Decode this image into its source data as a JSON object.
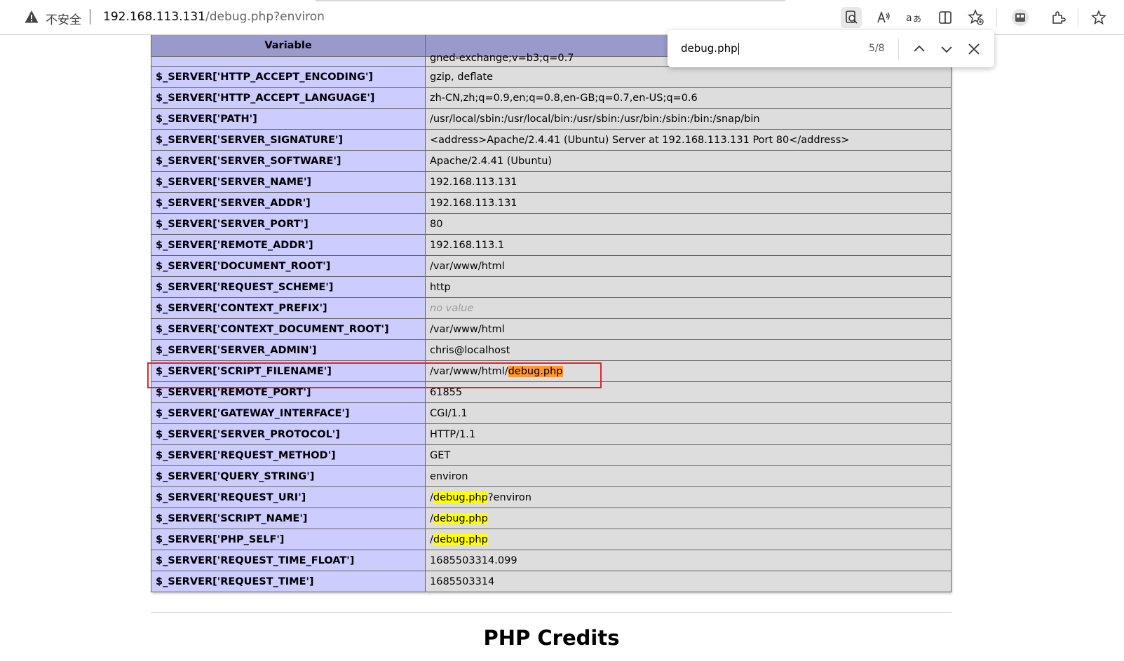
{
  "browser": {
    "security_label": "不安全",
    "url_host": "192.168.113.131",
    "url_rest": "/debug.php?environ"
  },
  "find": {
    "query": "debug.php",
    "count": "5/8"
  },
  "table": {
    "header_variable": "Variable",
    "partial_value": "gned-exchange;v=b3;q=0.7",
    "rows": [
      {
        "name": "$_SERVER['HTTP_ACCEPT_ENCODING']",
        "value": "gzip, deflate"
      },
      {
        "name": "$_SERVER['HTTP_ACCEPT_LANGUAGE']",
        "value": "zh-CN,zh;q=0.9,en;q=0.8,en-GB;q=0.7,en-US;q=0.6"
      },
      {
        "name": "$_SERVER['PATH']",
        "value": "/usr/local/sbin:/usr/local/bin:/usr/sbin:/usr/bin:/sbin:/bin:/snap/bin"
      },
      {
        "name": "$_SERVER['SERVER_SIGNATURE']",
        "value": "<address>Apache/2.4.41 (Ubuntu) Server at 192.168.113.131 Port 80</address>"
      },
      {
        "name": "$_SERVER['SERVER_SOFTWARE']",
        "value": "Apache/2.4.41 (Ubuntu)"
      },
      {
        "name": "$_SERVER['SERVER_NAME']",
        "value": "192.168.113.131"
      },
      {
        "name": "$_SERVER['SERVER_ADDR']",
        "value": "192.168.113.131"
      },
      {
        "name": "$_SERVER['SERVER_PORT']",
        "value": "80"
      },
      {
        "name": "$_SERVER['REMOTE_ADDR']",
        "value": "192.168.113.1"
      },
      {
        "name": "$_SERVER['DOCUMENT_ROOT']",
        "value": "/var/www/html"
      },
      {
        "name": "$_SERVER['REQUEST_SCHEME']",
        "value": "http"
      },
      {
        "name": "$_SERVER['CONTEXT_PREFIX']",
        "value": "no value"
      },
      {
        "name": "$_SERVER['CONTEXT_DOCUMENT_ROOT']",
        "value": "/var/www/html"
      },
      {
        "name": "$_SERVER['SERVER_ADMIN']",
        "value": "chris@localhost"
      },
      {
        "name": "$_SERVER['SCRIPT_FILENAME']",
        "value_prefix": "/var/www/html/",
        "value_hl": "debug.php",
        "value_suffix": ""
      },
      {
        "name": "$_SERVER['REMOTE_PORT']",
        "value": "61855"
      },
      {
        "name": "$_SERVER['GATEWAY_INTERFACE']",
        "value": "CGI/1.1"
      },
      {
        "name": "$_SERVER['SERVER_PROTOCOL']",
        "value": "HTTP/1.1"
      },
      {
        "name": "$_SERVER['REQUEST_METHOD']",
        "value": "GET"
      },
      {
        "name": "$_SERVER['QUERY_STRING']",
        "value": "environ"
      },
      {
        "name": "$_SERVER['REQUEST_URI']",
        "value_prefix": "/",
        "value_hl": "debug.php",
        "value_suffix": "?environ"
      },
      {
        "name": "$_SERVER['SCRIPT_NAME']",
        "value_prefix": "/",
        "value_hl": "debug.php",
        "value_suffix": ""
      },
      {
        "name": "$_SERVER['PHP_SELF']",
        "value_prefix": "/",
        "value_hl": "debug.php",
        "value_suffix": ""
      },
      {
        "name": "$_SERVER['REQUEST_TIME_FLOAT']",
        "value": "1685503314.099"
      },
      {
        "name": "$_SERVER['REQUEST_TIME']",
        "value": "1685503314"
      }
    ]
  },
  "credits_heading": "PHP Credits",
  "colors": {
    "name_cell": "#ccccff",
    "value_cell": "#dddddd",
    "header": "#9999cc",
    "match_highlight": "#ffff00",
    "current_match": "#ff9632",
    "annotation_box": "#e0262b"
  }
}
